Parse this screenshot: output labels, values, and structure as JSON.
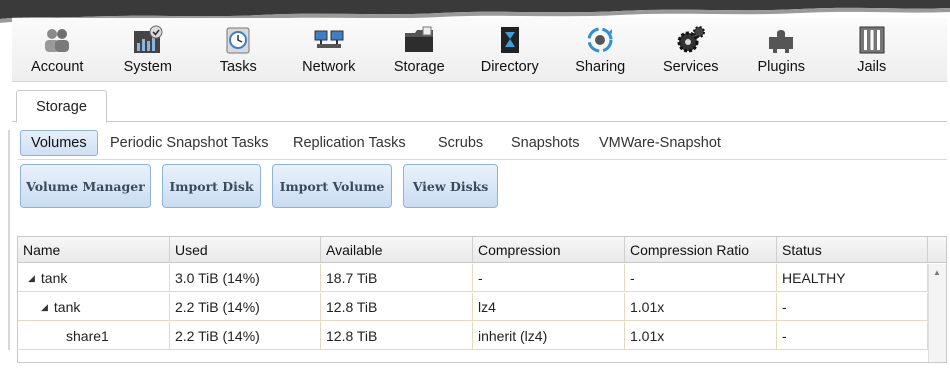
{
  "toolbar": {
    "items": [
      {
        "label": "Account",
        "icon": "account-icon"
      },
      {
        "label": "System",
        "icon": "system-icon"
      },
      {
        "label": "Tasks",
        "icon": "tasks-icon"
      },
      {
        "label": "Network",
        "icon": "network-icon"
      },
      {
        "label": "Storage",
        "icon": "storage-icon"
      },
      {
        "label": "Directory",
        "icon": "directory-icon"
      },
      {
        "label": "Sharing",
        "icon": "sharing-icon"
      },
      {
        "label": "Services",
        "icon": "services-icon"
      },
      {
        "label": "Plugins",
        "icon": "plugins-icon"
      },
      {
        "label": "Jails",
        "icon": "jails-icon"
      }
    ]
  },
  "tabs": {
    "storage": "Storage"
  },
  "subtabs": {
    "volumes": "Volumes",
    "periodic": "Periodic Snapshot Tasks",
    "replication": "Replication Tasks",
    "scrubs": "Scrubs",
    "snapshots": "Snapshots",
    "vmware": "VMWare-Snapshot"
  },
  "actions": {
    "volume_manager": "Volume Manager",
    "import_disk": "Import Disk",
    "import_volume": "Import Volume",
    "view_disks": "View Disks"
  },
  "table": {
    "columns": [
      "Name",
      "Used",
      "Available",
      "Compression",
      "Compression Ratio",
      "Status"
    ],
    "rows": [
      {
        "name": "tank",
        "used": "3.0 TiB (14%)",
        "available": "18.7 TiB",
        "compression": "-",
        "ratio": "-",
        "status": "HEALTHY"
      },
      {
        "name": "tank",
        "used": "2.2 TiB (14%)",
        "available": "12.8 TiB",
        "compression": "lz4",
        "ratio": "1.01x",
        "status": "-"
      },
      {
        "name": "share1",
        "used": "2.2 TiB (14%)",
        "available": "12.8 TiB",
        "compression": "inherit (lz4)",
        "ratio": "1.01x",
        "status": "-"
      }
    ]
  },
  "colors": {
    "accent": "#cfe0f4",
    "button_border": "#8fb2d8"
  }
}
